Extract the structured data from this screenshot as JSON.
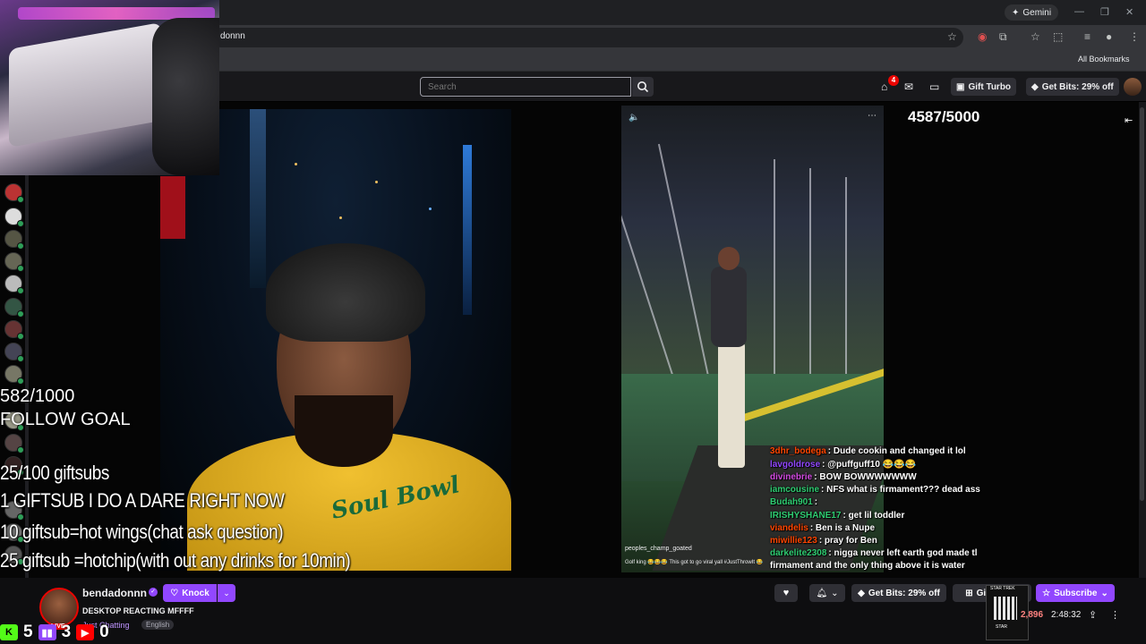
{
  "browser": {
    "url": "donnn",
    "gemini_label": "Gemini",
    "all_bookmarks_label": "All Bookmarks"
  },
  "twitch_nav": {
    "search_placeholder": "Search",
    "notification_count": "4",
    "gift_turbo_label": "Gift Turbo",
    "get_bits_label": "Get Bits: 29% off"
  },
  "overlay": {
    "follow_counter": "4587/5000",
    "goal_count": "582/1000",
    "goal_label": "FOLLOW GOAL",
    "gift_lines": [
      "25/100 giftsubs",
      "1 GIFTSUB I DO A DARE RIGHT NOW",
      "10 giftsub=hot wings(chat ask question)",
      "25 giftsub =hotchip(with out any drinks for 10min)"
    ]
  },
  "clip": {
    "username": "peoples_champ_goated",
    "caption": "Golf king 😂😂😂 This got to go viral yall #JustThrowIt 😂"
  },
  "chat": [
    {
      "user": "3dhr_bodega",
      "text": "Dude cookin and changed it lol",
      "color": "#ff4500"
    },
    {
      "user": "lavgoldrose",
      "text": "@puffguff10 😂😂😂",
      "color": "#9147ff"
    },
    {
      "user": "divinebrie",
      "text": "BOW BOWWWWWWW",
      "color": "#d14ae0"
    },
    {
      "user": "iamcousine",
      "text": "NFS what is firmament??? dead ass",
      "color": "#2ecc71"
    },
    {
      "user": "Budah901",
      "text": "",
      "color": "#2ecc71"
    },
    {
      "user": "IRISHYSHANE17",
      "text": "get lil toddler",
      "color": "#2ecc71"
    },
    {
      "user": "viandelis",
      "text": "Ben is a Nupe",
      "color": "#ff4500"
    },
    {
      "user": "miwillie123",
      "text": "pray for Ben",
      "color": "#ff4500"
    },
    {
      "user": "darkelite2308",
      "text": "nigga never left earth god made tl",
      "color": "#2ecc71"
    },
    {
      "user": "",
      "text": "firmament and the only thing above it is water",
      "color": "#ffffff"
    }
  ],
  "channel": {
    "name": "bendadonnn",
    "knock_label": "Knock",
    "title": "DESKTOP REACTING MFFFF",
    "category": "Just Chatting",
    "language": "English",
    "live_label": "LIVE"
  },
  "social": {
    "kick_count": "5",
    "twitch_count": "3",
    "youtube_count": "0"
  },
  "actions": {
    "get_bits_label": "Get Bits: 29% off",
    "gift_sub_label": "Gift a Sub",
    "subscribe_label": "Subscribe",
    "viewers": "2,896",
    "uptime": "2:48:32"
  },
  "qr": {
    "top_label": "STAR TREK",
    "bottom_label": "STAR"
  },
  "colors": {
    "twitch_purple": "#9147ff",
    "live_red": "#eb0400"
  }
}
